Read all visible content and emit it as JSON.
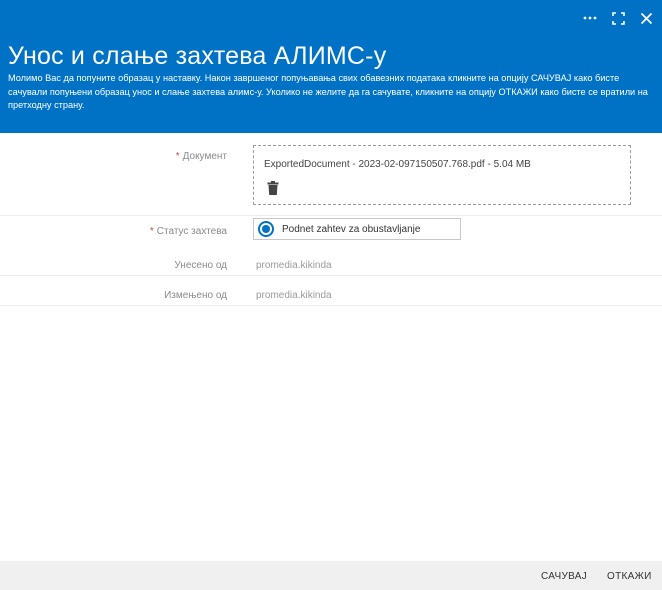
{
  "dialog": {
    "title": "Унос и слање захтева АЛИМС-у",
    "subtitle": "Молимо Вас да попуните образац у наставку. Након завршеног попуњавања свих обавезних података кликните на опцију САЧУВАЈ како бисте сачували попуњени образац унос и слање захтева алимс-у. Уколико не желите да га сачувате, кликните на опцију ОТКАЖИ како бисте се вратили на претходну страну.",
    "controls": {
      "more_icon": "ellipsis-icon",
      "maximize_icon": "maximize-icon",
      "close_icon": "close-icon"
    }
  },
  "form": {
    "required_marker": "*",
    "document": {
      "label": "Документ",
      "file": "ExportedDocument - 2023-02-097150507.768.pdf - 5.04 MB",
      "delete_icon": "trash-icon"
    },
    "status": {
      "label": "Статус захтева",
      "value": "Podnet zahtev za obustavljanje"
    },
    "created_by": {
      "label": "Унесено од",
      "value": "promedia.kikinda"
    },
    "modified_by": {
      "label": "Измењено од",
      "value": "promedia.kikinda"
    }
  },
  "footer": {
    "save_label": "САЧУВАЈ",
    "cancel_label": "ОТКАЖИ"
  },
  "colors": {
    "header_bg": "#0072c6",
    "accent": "#0072c6",
    "required": "#c0504d"
  }
}
